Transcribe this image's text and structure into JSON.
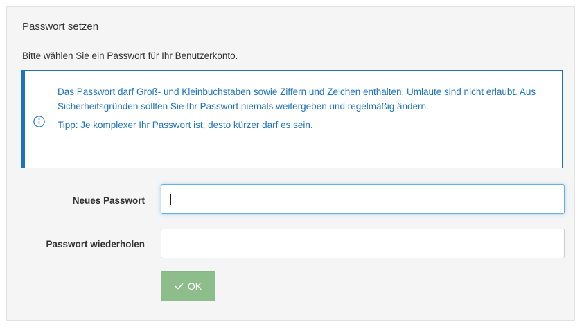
{
  "panel": {
    "title": "Passwort setzen",
    "subtitle": "Bitte wählen Sie ein Passwort für Ihr Benutzerkonto."
  },
  "info": {
    "icon": "info-circle-icon",
    "text": "Das Passwort darf Groß- und Kleinbuchstaben sowie Ziffern und Zeichen enthalten. Umlaute sind nicht erlaubt. Aus Sicherheitsgründen sollten Sie Ihr Passwort niemals weitergeben und regelmäßig ändern.",
    "tip": "Tipp: Je komplexer Ihr Passwort ist, desto kürzer darf es sein.",
    "color": "#1e73be"
  },
  "form": {
    "new_password_label": "Neues Passwort",
    "new_password_value": "",
    "repeat_password_label": "Passwort wiederholen",
    "repeat_password_value": "",
    "ok_icon": "checkmark-icon",
    "ok_label": "OK",
    "ok_color": "#8cbd8a"
  }
}
